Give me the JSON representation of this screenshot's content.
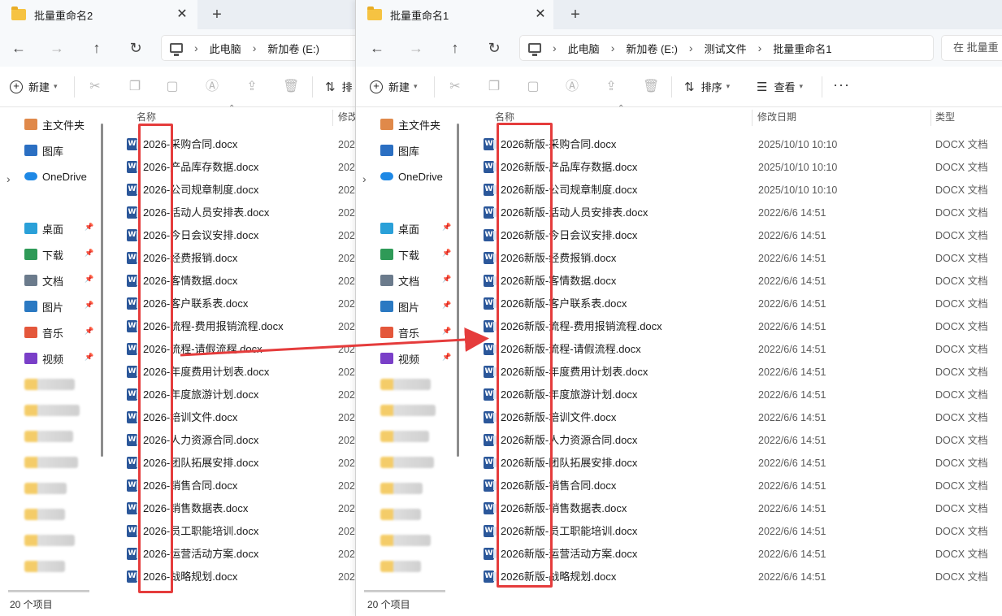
{
  "left_window": {
    "tab_title": "批量重命名2",
    "breadcrumb": [
      "此电脑",
      "新加卷 (E:)"
    ],
    "toolbar": {
      "new_label": "新建",
      "sort_label_partial": "排"
    },
    "column_headers": {
      "name": "名称",
      "modified": "修改"
    },
    "date_partial": "202",
    "files": [
      "2026-采购合同.docx",
      "2026-产品库存数据.docx",
      "2026-公司规章制度.docx",
      "2026-活动人员安排表.docx",
      "2026-今日会议安排.docx",
      "2026-经费报销.docx",
      "2026-客情数据.docx",
      "2026-客户联系表.docx",
      "2026-流程-费用报销流程.docx",
      "2026-流程-请假流程.docx",
      "2026-年度费用计划表.docx",
      "2026-年度旅游计划.docx",
      "2026-培训文件.docx",
      "2026-人力资源合同.docx",
      "2026-团队拓展安排.docx",
      "2026-销售合同.docx",
      "2026-销售数据表.docx",
      "2026-员工职能培训.docx",
      "2026-运营活动方案.docx",
      "2026-战略规划.docx"
    ],
    "status": "20 个项目"
  },
  "right_window": {
    "tab_title": "批量重命名1",
    "breadcrumb": [
      "此电脑",
      "新加卷 (E:)",
      "测试文件",
      "批量重命名1"
    ],
    "search_placeholder": "在 批量重",
    "toolbar": {
      "new_label": "新建",
      "sort_label": "排序",
      "view_label": "查看",
      "more": "···"
    },
    "column_headers": {
      "name": "名称",
      "modified": "修改日期",
      "type": "类型"
    },
    "files": [
      {
        "name": "2026新版-采购合同.docx",
        "date": "2025/10/10 10:10",
        "type": "DOCX 文档"
      },
      {
        "name": "2026新版-产品库存数据.docx",
        "date": "2025/10/10 10:10",
        "type": "DOCX 文档"
      },
      {
        "name": "2026新版-公司规章制度.docx",
        "date": "2025/10/10 10:10",
        "type": "DOCX 文档"
      },
      {
        "name": "2026新版-活动人员安排表.docx",
        "date": "2022/6/6 14:51",
        "type": "DOCX 文档"
      },
      {
        "name": "2026新版-今日会议安排.docx",
        "date": "2022/6/6 14:51",
        "type": "DOCX 文档"
      },
      {
        "name": "2026新版-经费报销.docx",
        "date": "2022/6/6 14:51",
        "type": "DOCX 文档"
      },
      {
        "name": "2026新版-客情数据.docx",
        "date": "2022/6/6 14:51",
        "type": "DOCX 文档"
      },
      {
        "name": "2026新版-客户联系表.docx",
        "date": "2022/6/6 14:51",
        "type": "DOCX 文档"
      },
      {
        "name": "2026新版-流程-费用报销流程.docx",
        "date": "2022/6/6 14:51",
        "type": "DOCX 文档"
      },
      {
        "name": "2026新版-流程-请假流程.docx",
        "date": "2022/6/6 14:51",
        "type": "DOCX 文档"
      },
      {
        "name": "2026新版-年度费用计划表.docx",
        "date": "2022/6/6 14:51",
        "type": "DOCX 文档"
      },
      {
        "name": "2026新版-年度旅游计划.docx",
        "date": "2022/6/6 14:51",
        "type": "DOCX 文档"
      },
      {
        "name": "2026新版-培训文件.docx",
        "date": "2022/6/6 14:51",
        "type": "DOCX 文档"
      },
      {
        "name": "2026新版-人力资源合同.docx",
        "date": "2022/6/6 14:51",
        "type": "DOCX 文档"
      },
      {
        "name": "2026新版-团队拓展安排.docx",
        "date": "2022/6/6 14:51",
        "type": "DOCX 文档"
      },
      {
        "name": "2026新版-销售合同.docx",
        "date": "2022/6/6 14:51",
        "type": "DOCX 文档"
      },
      {
        "name": "2026新版-销售数据表.docx",
        "date": "2022/6/6 14:51",
        "type": "DOCX 文档"
      },
      {
        "name": "2026新版-员工职能培训.docx",
        "date": "2022/6/6 14:51",
        "type": "DOCX 文档"
      },
      {
        "name": "2026新版-运营活动方案.docx",
        "date": "2022/6/6 14:51",
        "type": "DOCX 文档"
      },
      {
        "name": "2026新版-战略规划.docx",
        "date": "2022/6/6 14:51",
        "type": "DOCX 文档"
      }
    ],
    "status": "20 个项目"
  },
  "sidebar": {
    "items": [
      {
        "label": "主文件夹",
        "icon": "home-icon"
      },
      {
        "label": "图库",
        "icon": "gallery-icon"
      },
      {
        "label": "OneDrive",
        "icon": "cloud-icon"
      },
      {
        "label": "桌面",
        "icon": "desktop-icon"
      },
      {
        "label": "下载",
        "icon": "download-icon"
      },
      {
        "label": "文档",
        "icon": "document-icon"
      },
      {
        "label": "图片",
        "icon": "picture-icon"
      },
      {
        "label": "音乐",
        "icon": "music-icon"
      },
      {
        "label": "视频",
        "icon": "video-icon"
      }
    ]
  },
  "colors": {
    "annotation_red": "#e53c3c",
    "word_blue": "#2b579a",
    "folder_yellow": "#f6c342"
  }
}
